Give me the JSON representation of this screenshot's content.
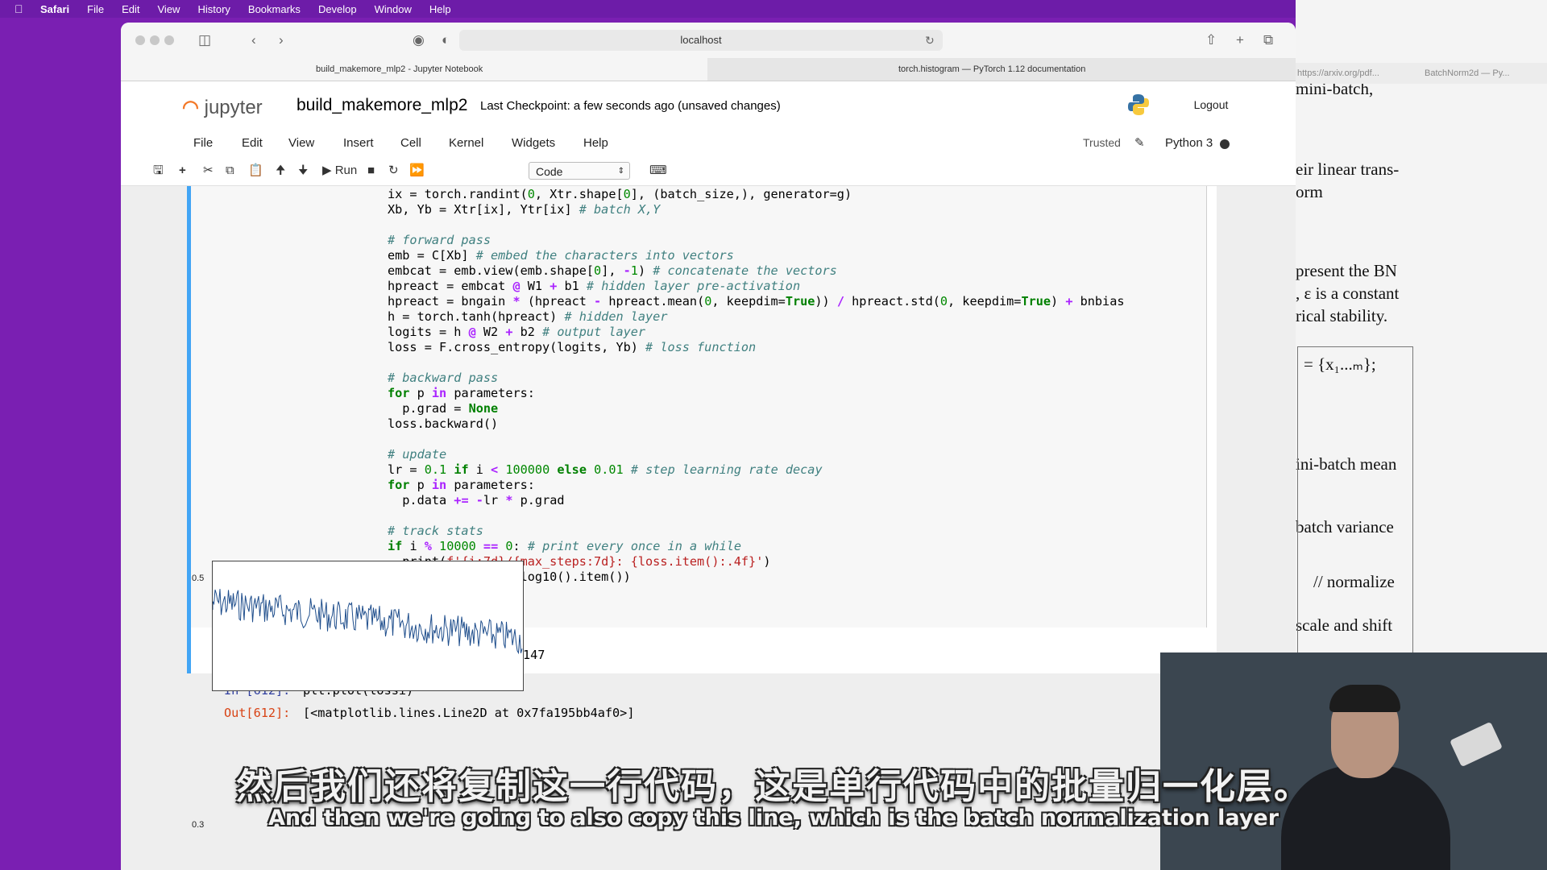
{
  "menubar": {
    "app": "Safari",
    "items": [
      "File",
      "Edit",
      "View",
      "History",
      "Bookmarks",
      "Develop",
      "Window",
      "Help"
    ]
  },
  "browser": {
    "url": "localhost",
    "tabs": [
      "build_makemore_mlp2 - Jupyter Notebook",
      "torch.histogram — PyTorch 1.12 documentation",
      "https://arxiv.org/pdf...",
      "BatchNorm2d — Py..."
    ]
  },
  "jupyter": {
    "logo_text": "jupyter",
    "notebook_title": "build_makemore_mlp2",
    "checkpoint": "Last Checkpoint: a few seconds ago",
    "unsaved": "(unsaved changes)",
    "logout": "Logout",
    "menu": [
      "File",
      "Edit",
      "View",
      "Insert",
      "Cell",
      "Kernel",
      "Widgets",
      "Help"
    ],
    "trusted": "Trusted",
    "kernel": "Python 3",
    "toolbar": {
      "run_label": "Run",
      "cell_type": "Code"
    }
  },
  "cell_main": {
    "output": "0/ 200000: 3.3147"
  },
  "cell_plot": {
    "in_prompt": "In [612]:",
    "in_code": "plt.plot(lossi)",
    "out_prompt": "Out[612]:",
    "out_text": "[<matplotlib.lines.Line2D at 0x7fa195bb4af0>]",
    "ytick_top": "0.5",
    "ytick_bottom": "0.3"
  },
  "pdf_fragments": [
    "mini-batch,",
    "eir linear trans-",
    "orm",
    "present the BN",
    ", ε is a constant",
    "rical stability.",
    "= {x₁...ₘ};",
    "ini-batch mean",
    "batch variance",
    "// normalize",
    "scale and shift"
  ],
  "subtitles": {
    "zh": "然后我们还将复制这一行代码，这是单行代码中的批量归一化层。",
    "en": "And then we're going to also copy this line, which is the batch normalization layer"
  },
  "colors": {
    "desktop": "#7a1fb2",
    "cell_border": "#42a5f5",
    "jupyter_orange": "#f37726"
  }
}
